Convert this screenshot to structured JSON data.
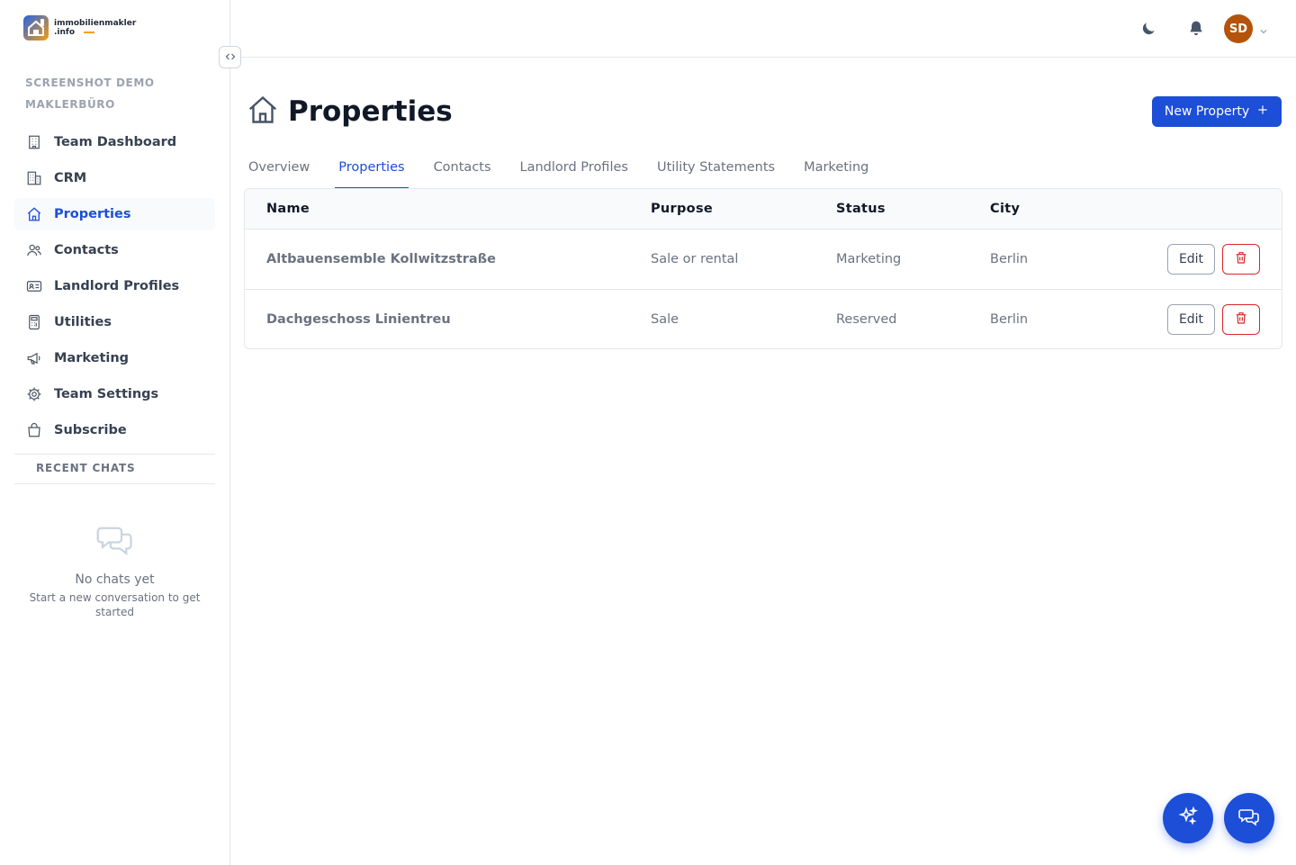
{
  "brand": {
    "line1": "immobilienmakler",
    "line2": ".info"
  },
  "sidebar": {
    "org_name": "SCREENSHOT DEMO MAKLERBÜRO",
    "items": [
      {
        "label": "Team Dashboard",
        "icon": "building-icon"
      },
      {
        "label": "CRM",
        "icon": "office-building-icon"
      },
      {
        "label": "Properties",
        "icon": "home-icon",
        "active": true
      },
      {
        "label": "Contacts",
        "icon": "users-icon"
      },
      {
        "label": "Landlord Profiles",
        "icon": "id-card-icon"
      },
      {
        "label": "Utilities",
        "icon": "calculator-icon"
      },
      {
        "label": "Marketing",
        "icon": "megaphone-icon"
      },
      {
        "label": "Team Settings",
        "icon": "gear-icon"
      },
      {
        "label": "Subscribe",
        "icon": "shopping-bag-icon"
      }
    ],
    "recent_chats_title": "RECENT CHATS",
    "empty_title": "No chats yet",
    "empty_subtitle": "Start a new conversation to get started"
  },
  "topbar": {
    "avatar_initials": "SD"
  },
  "page": {
    "title": "Properties",
    "new_button": "New Property"
  },
  "tabs": [
    {
      "label": "Overview"
    },
    {
      "label": "Properties",
      "active": true
    },
    {
      "label": "Contacts"
    },
    {
      "label": "Landlord Profiles"
    },
    {
      "label": "Utility Statements"
    },
    {
      "label": "Marketing"
    }
  ],
  "table": {
    "columns": [
      "Name",
      "Purpose",
      "Status",
      "City"
    ],
    "rows": [
      {
        "name": "Altbauensemble Kollwitzstraße",
        "purpose": "Sale or rental",
        "status": "Marketing",
        "city": "Berlin",
        "edit": "Edit"
      },
      {
        "name": "Dachgeschoss Linientreu",
        "purpose": "Sale",
        "status": "Reserved",
        "city": "Berlin",
        "edit": "Edit"
      }
    ]
  },
  "colors": {
    "primary": "#1d4ed8",
    "avatar": "#b45309",
    "danger": "#dc2626"
  }
}
